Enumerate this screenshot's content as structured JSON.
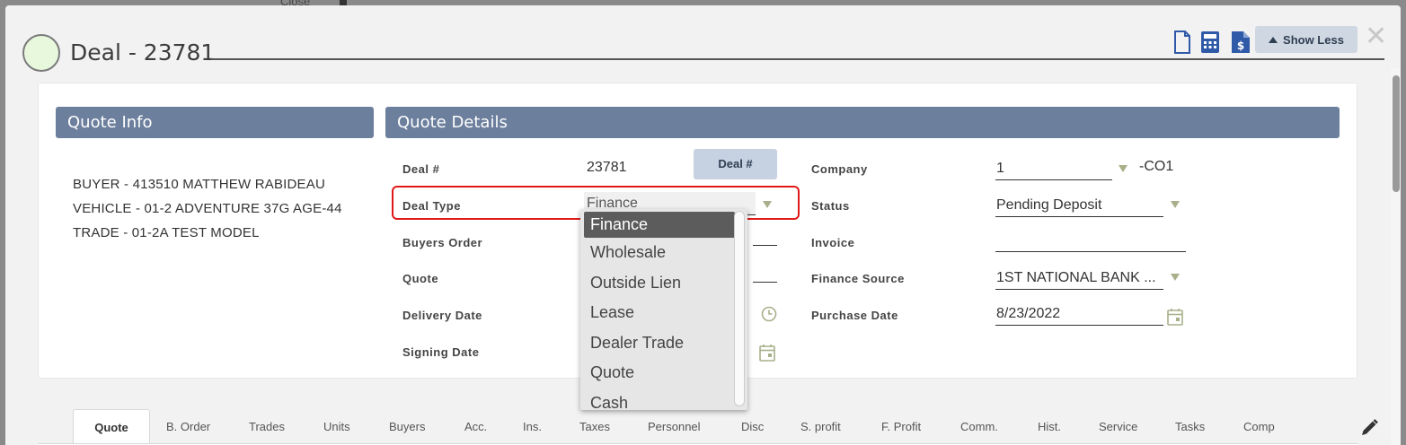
{
  "backdrop": {
    "close_label": "Close"
  },
  "header": {
    "title": "Deal - 23781",
    "show_less_label": "Show Less",
    "icons": [
      "document-icon",
      "calculator-icon",
      "invoice-dollar-icon"
    ]
  },
  "quote_info": {
    "title": "Quote Info",
    "lines": [
      "BUYER - 413510 MATTHEW RABIDEAU",
      "VEHICLE - 01-2 ADVENTURE 37G  AGE-44",
      "TRADE - 01-2A TEST MODEL"
    ]
  },
  "quote_details": {
    "title": "Quote Details",
    "deal_badge": "Deal #",
    "left_fields": {
      "deal_no": {
        "label": "Deal #",
        "value": "23781"
      },
      "deal_type": {
        "label": "Deal Type",
        "value": "Finance"
      },
      "buyers_order": {
        "label": "Buyers Order"
      },
      "quote": {
        "label": "Quote"
      },
      "delivery_date": {
        "label": "Delivery Date"
      },
      "signing_date": {
        "label": "Signing Date"
      }
    },
    "right_fields": {
      "company": {
        "label": "Company",
        "value": "1",
        "suffix": "-CO1"
      },
      "status": {
        "label": "Status",
        "value": "Pending Deposit"
      },
      "invoice": {
        "label": "Invoice",
        "value": ""
      },
      "finance_source": {
        "label": "Finance Source",
        "value": "1ST NATIONAL BANK ..."
      },
      "purchase_date": {
        "label": "Purchase Date",
        "value": "8/23/2022"
      }
    }
  },
  "deal_type_options": [
    "Finance",
    "Wholesale",
    "Outside Lien",
    "Lease",
    "Dealer Trade",
    "Quote",
    "Cash"
  ],
  "tabs": [
    "Quote",
    "B. Order",
    "Trades",
    "Units",
    "Buyers",
    "Acc.",
    "Ins.",
    "Taxes",
    "Personnel",
    "Disc",
    "S. profit",
    "F. Profit",
    "Comm.",
    "Hist.",
    "Service",
    "Tasks",
    "Comp"
  ],
  "colors": {
    "section_header": "#6c7f9d",
    "highlight_border": "#e01818",
    "dropdown_selected": "#5c5c5c"
  }
}
